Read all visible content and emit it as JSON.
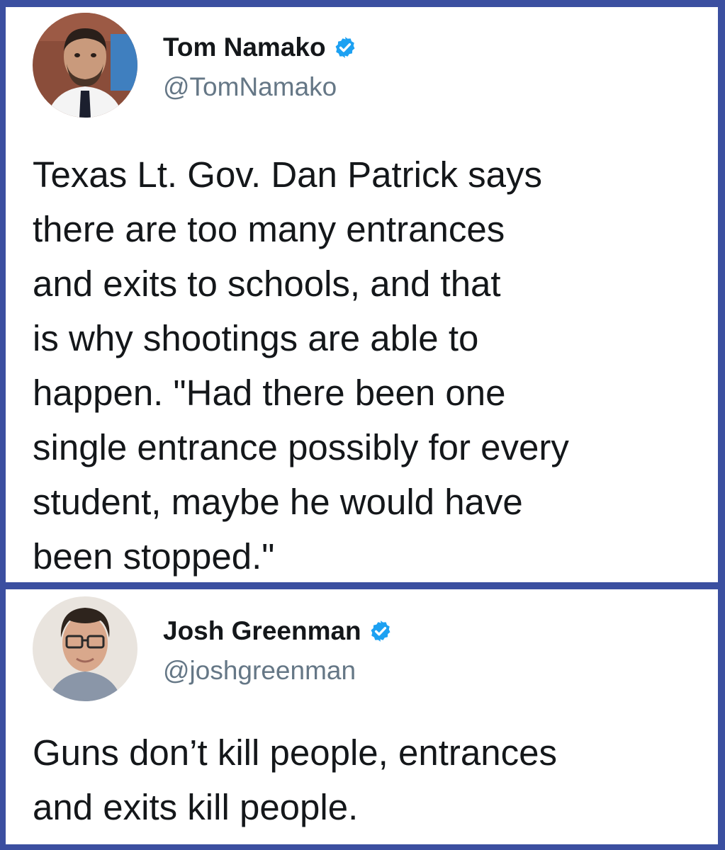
{
  "tweets": [
    {
      "author": {
        "name": "Tom Namako",
        "handle": "@TomNamako",
        "verified": true
      },
      "avatar": {
        "icon": "person-photo-icon",
        "skin": "#c99a7c",
        "hair": "#2a1f1a",
        "bg": "#8a4d3a",
        "shirt": "#f4f4f4",
        "tie": "#1b1f2e"
      },
      "lines": [
        "Texas Lt. Gov. Dan Patrick says",
        "there are too many entrances",
        "and exits to schools, and that",
        "is why shootings are able to",
        "happen. \"Had there been one",
        "single entrance possibly for every",
        "student, maybe he would have",
        "been stopped.\""
      ]
    },
    {
      "author": {
        "name": "Josh Greenman",
        "handle": "@joshgreenman",
        "verified": true
      },
      "avatar": {
        "icon": "person-photo-icon",
        "skin": "#d9a88c",
        "hair": "#2e241d",
        "bg": "#e9e4de",
        "shirt": "#8a96a8"
      },
      "lines": [
        "Guns don’t kill people, entrances",
        "and exits kill people."
      ]
    }
  ],
  "colors": {
    "frame": "#3b4fa0",
    "verified": "#1da1f2",
    "text": "#14171a",
    "handle": "#657786"
  }
}
